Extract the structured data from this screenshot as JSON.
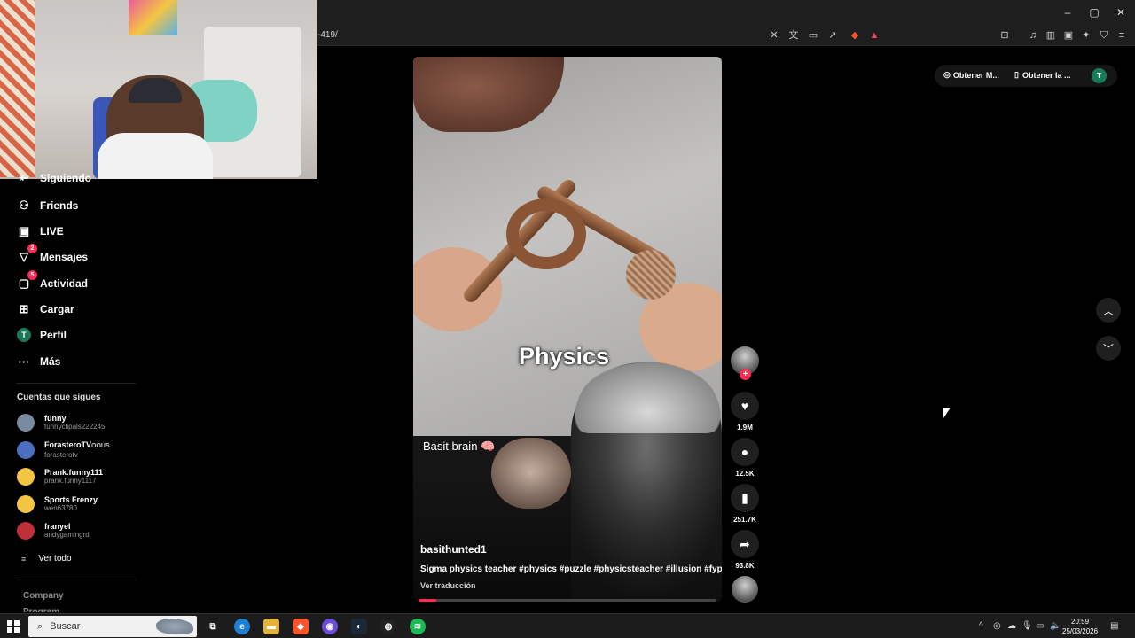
{
  "browser": {
    "url": "-419/",
    "window_controls": [
      "minimize-icon",
      "restore-icon",
      "close-icon"
    ],
    "toolbar_icons": [
      "mute-tab-icon",
      "translate-icon",
      "cast-icon",
      "share-icon",
      "brave-shield-icon",
      "brave-rewards-icon",
      "screenshot-icon",
      "media-icon",
      "sidebar-icon",
      "wallet-icon",
      "leo-icon",
      "vpn-icon",
      "menu-icon"
    ]
  },
  "sidebar": {
    "items": [
      {
        "label": "Siguiendo",
        "icon": "following-icon"
      },
      {
        "label": "Friends",
        "icon": "friends-icon"
      },
      {
        "label": "LIVE",
        "icon": "live-icon"
      },
      {
        "label": "Mensajes",
        "icon": "messages-icon",
        "badge": "2"
      },
      {
        "label": "Actividad",
        "icon": "activity-icon",
        "badge": "5"
      },
      {
        "label": "Cargar",
        "icon": "upload-icon"
      },
      {
        "label": "Perfil",
        "icon": "profile-avatar",
        "avatar_letter": "T"
      },
      {
        "label": "Más",
        "icon": "more-icon"
      }
    ],
    "following_title": "Cuentas que sigues",
    "accounts": [
      {
        "name": "funny",
        "handle": "funnyclipals222245",
        "color": "#7a8aa0"
      },
      {
        "name": "ForasteroTV",
        "name_suffix": "OOUS",
        "handle": "forasterotv",
        "color": "#4a6fc0"
      },
      {
        "name": "Prank.funny111",
        "handle": "prank.funny1117",
        "color": "#f4c542"
      },
      {
        "name": "Sports Frenzy",
        "handle": "wen63780",
        "color": "#f4c542"
      },
      {
        "name": "franyel",
        "handle": "andygamingrd",
        "color": "#c0303a"
      }
    ],
    "see_all": "Ver todo",
    "footer": [
      "Company",
      "Program"
    ]
  },
  "video": {
    "overlay_text": "Physics",
    "caption_top": "Basit brain 🧠",
    "author": "basithunted1",
    "description": "Sigma physics teacher #physics #puzzle #physicsteacher #illusion #fyp",
    "translate": "Ver traducción",
    "progress": 0.06
  },
  "actions": {
    "likes": "1.9M",
    "comments": "12.5K",
    "saves": "251.7K",
    "shares": "93.8K"
  },
  "top_right": {
    "get_app_1": "Obtener M...",
    "get_app_2": "Obtener la ...",
    "user_letter": "T"
  },
  "taskbar": {
    "search_placeholder": "Buscar",
    "time": "20:59",
    "date": "25/03/2026"
  },
  "colors": {
    "accent": "#fe2c55",
    "avatar_green": "#1a7a5a"
  }
}
